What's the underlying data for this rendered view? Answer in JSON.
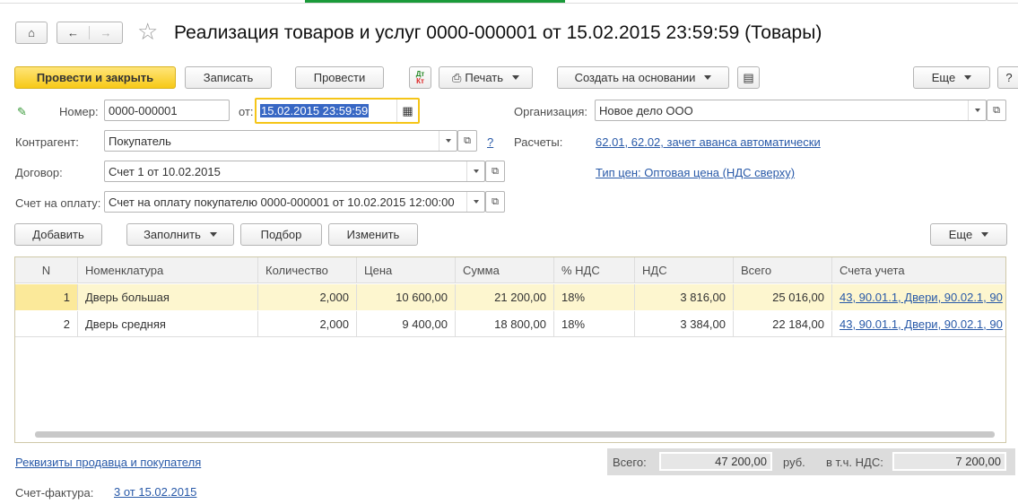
{
  "window": {
    "title": "Реализация товаров и услуг 0000-000001 от 15.02.2015 23:59:59 (Товары)"
  },
  "toolbar": {
    "post_close": "Провести и закрыть",
    "save": "Записать",
    "post": "Провести",
    "dtkt": "Дт Кт",
    "print": "Печать",
    "create_based": "Создать на основании",
    "more": "Еще",
    "help": "?"
  },
  "form": {
    "number_label": "Номер:",
    "number_value": "0000-000001",
    "date_label": "от:",
    "date_value": "15.02.2015 23:59:59",
    "org_label": "Организация:",
    "org_value": "Новое дело ООО",
    "counterparty_label": "Контрагент:",
    "counterparty_value": "Покупатель",
    "counterparty_help": "?",
    "settlements_label": "Расчеты:",
    "settlements_link": "62.01, 62.02, зачет аванса автоматически",
    "contract_label": "Договор:",
    "contract_value": "Счет 1 от 10.02.2015",
    "price_type_link": "Тип цен: Оптовая цена (НДС сверху)",
    "invoice_label": "Счет на оплату:",
    "invoice_value": "Счет на оплату покупателю 0000-000001 от 10.02.2015 12:00:00"
  },
  "table_toolbar": {
    "add": "Добавить",
    "fill": "Заполнить",
    "select": "Подбор",
    "change": "Изменить",
    "more": "Еще"
  },
  "table": {
    "columns": [
      "N",
      "Номенклатура",
      "Количество",
      "Цена",
      "Сумма",
      "% НДС",
      "НДС",
      "Всего",
      "Счета учета"
    ],
    "rows": [
      [
        "1",
        "Дверь большая",
        "2,000",
        "10 600,00",
        "21 200,00",
        "18%",
        "3 816,00",
        "25 016,00",
        "43, 90.01.1, Двери, 90.02.1, 90"
      ],
      [
        "2",
        "Дверь средняя",
        "2,000",
        "9 400,00",
        "18 800,00",
        "18%",
        "3 384,00",
        "22 184,00",
        "43, 90.01.1, Двери, 90.02.1, 90"
      ]
    ]
  },
  "footer": {
    "seller_buyer_link": "Реквизиты продавца и покупателя",
    "total_label": "Всего:",
    "total_value": "47 200,00",
    "currency": "руб.",
    "vat_label": "в т.ч. НДС:",
    "vat_value": "7 200,00",
    "invoice_label": "Счет-фактура:",
    "invoice_link": "3 от 15.02.2015"
  },
  "colors": {
    "primary": "#f7c917",
    "link": "#2859a8",
    "selected_row": "#fdf6cf",
    "focus": "#f5c518"
  }
}
